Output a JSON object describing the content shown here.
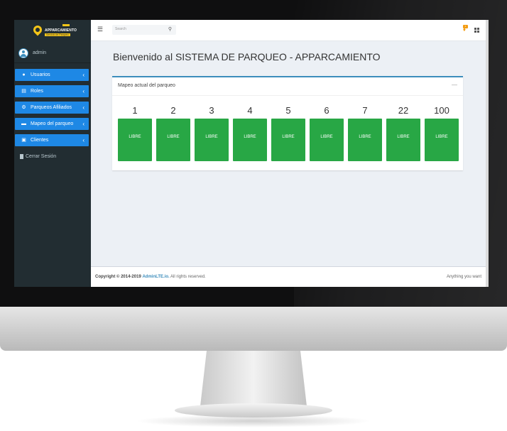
{
  "brand": {
    "name": "APPARCAMIENTO",
    "tagline": "Servicio de Parqueo"
  },
  "user": {
    "name": "admin"
  },
  "sidebar": {
    "items": [
      {
        "label": "Usuarios",
        "icon": "user-icon"
      },
      {
        "label": "Roles",
        "icon": "id-card-icon"
      },
      {
        "label": "Parqueos Afiliados",
        "icon": "gear-icon"
      },
      {
        "label": "Mapeo del parqueo",
        "icon": "car-icon"
      },
      {
        "label": "Clientes",
        "icon": "contact-icon"
      }
    ],
    "logout": "Cerrar Sesión"
  },
  "topbar": {
    "search_placeholder": "Search",
    "notification_count": "1"
  },
  "page": {
    "title": "Bienvenido al SISTEMA DE PARQUEO - APPARCAMIENTO"
  },
  "box": {
    "title": "Mapeo actual del parqueo",
    "spots": [
      {
        "number": "1",
        "status": "LIBRE"
      },
      {
        "number": "2",
        "status": "LIBRE"
      },
      {
        "number": "3",
        "status": "LIBRE"
      },
      {
        "number": "4",
        "status": "LIBRE"
      },
      {
        "number": "5",
        "status": "LIBRE"
      },
      {
        "number": "6",
        "status": "LIBRE"
      },
      {
        "number": "7",
        "status": "LIBRE"
      },
      {
        "number": "22",
        "status": "LIBRE"
      },
      {
        "number": "100",
        "status": "LIBRE"
      }
    ]
  },
  "footer": {
    "copyright": "Copyright © 2014-2019",
    "link": "AdminLTE.io.",
    "rights": "All rights reserved.",
    "right_text": "Anything you want"
  },
  "colors": {
    "accent": "#1e88e5",
    "free": "#28a745",
    "sidebar": "#222d32",
    "notification": "#f39c12"
  }
}
